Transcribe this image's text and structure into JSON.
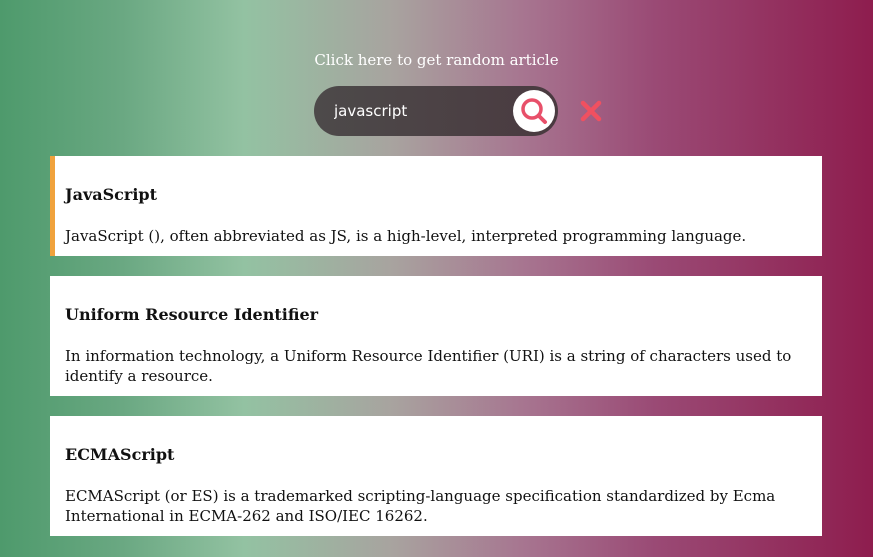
{
  "random_article_link": "Click here to get random article",
  "search": {
    "value": "javascript",
    "search_icon": "search-icon",
    "clear_icon": "close-icon"
  },
  "colors": {
    "accent_bar": "#f0a23c",
    "search_icon": "#e8506a",
    "clear_icon": "#f05060"
  },
  "results": [
    {
      "title": "JavaScript",
      "snippet": "JavaScript (), often abbreviated as JS, is a high-level, interpreted programming language."
    },
    {
      "title": "Uniform Resource Identifier",
      "snippet": "In information technology, a Uniform Resource Identifier (URI) is a string of characters used to identify a resource."
    },
    {
      "title": "ECMAScript",
      "snippet": "ECMAScript (or ES) is a trademarked scripting-language specification standardized by Ecma International in ECMA-262 and ISO/IEC 16262."
    }
  ]
}
